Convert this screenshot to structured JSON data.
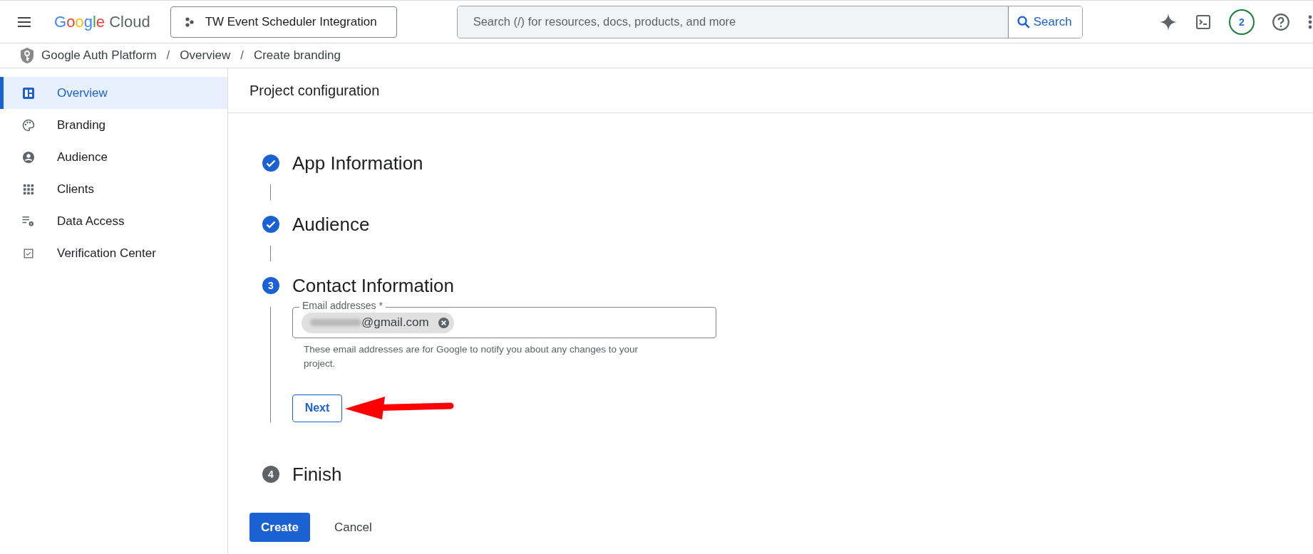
{
  "header": {
    "logo": {
      "brand": "Google",
      "product": "Cloud"
    },
    "project": "TW Event Scheduler Integration",
    "search": {
      "placeholder": "Search (/) for resources, docs, products, and more",
      "button": "Search"
    },
    "notifications": "2"
  },
  "breadcrumb": [
    {
      "label": "Google Auth Platform"
    },
    {
      "separator": "/",
      "label": "Overview"
    },
    {
      "separator": "/",
      "label": "Create branding"
    }
  ],
  "sidebar": {
    "items": [
      {
        "label": "Overview",
        "selected": true
      },
      {
        "label": "Branding",
        "selected": false
      },
      {
        "label": "Audience",
        "selected": false
      },
      {
        "label": "Clients",
        "selected": false
      },
      {
        "label": "Data Access",
        "selected": false
      },
      {
        "label": "Verification Center",
        "selected": false
      }
    ]
  },
  "page": {
    "title": "Project configuration",
    "steps": [
      {
        "kind": "done",
        "title": "App Information"
      },
      {
        "kind": "done",
        "title": "Audience"
      },
      {
        "kind": "active",
        "number": "3",
        "title": "Contact Information",
        "field": {
          "label": "Email addresses *",
          "chips": [
            "@gmail.com"
          ],
          "hint": "These email addresses are for Google to notify you about any changes to your project."
        },
        "button": "Next"
      },
      {
        "kind": "pending",
        "number": "4",
        "title": "Finish"
      }
    ],
    "actions": {
      "primary": "Create",
      "secondary": "Cancel"
    }
  }
}
